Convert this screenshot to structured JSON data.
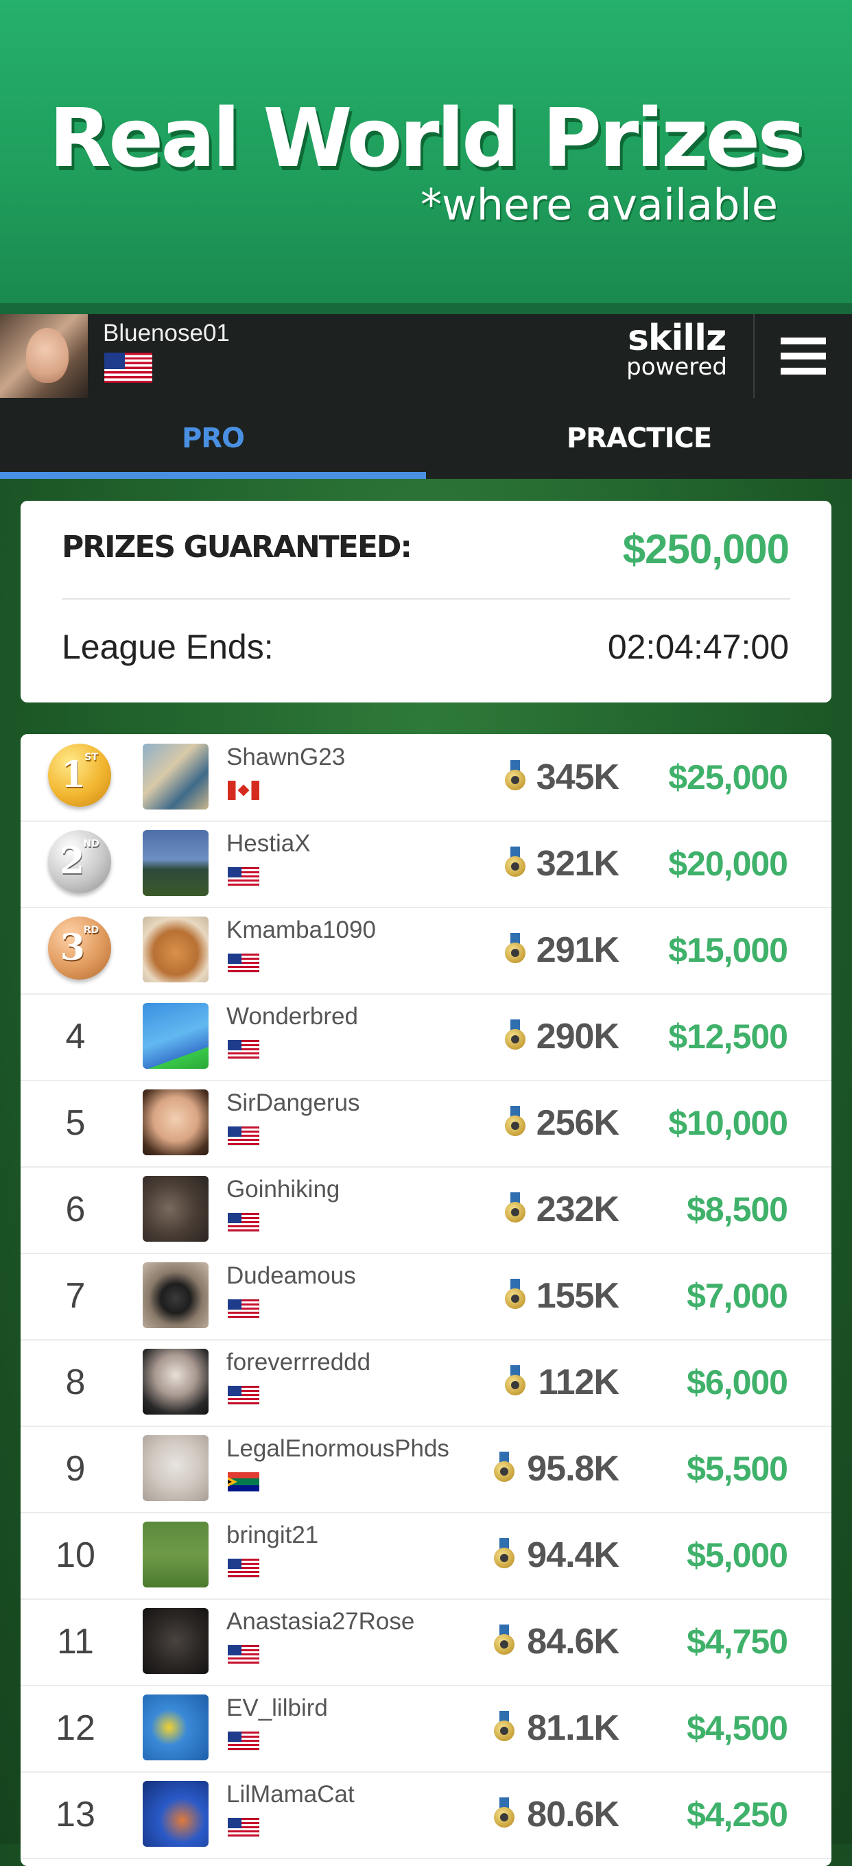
{
  "hero": {
    "title": "Real World Prizes",
    "subtitle": "*where available"
  },
  "header": {
    "username": "Bluenose01",
    "brand": "skillz",
    "brand_sub": "powered"
  },
  "tabs": [
    {
      "label": "PRO",
      "active": true
    },
    {
      "label": "PRACTICE",
      "active": false
    }
  ],
  "prizes": {
    "guaranteed_label": "PRIZES GUARANTEED:",
    "guaranteed_value": "$250,000",
    "league_label": "League Ends:",
    "league_value": "02:04:47:00"
  },
  "leaderboard": [
    {
      "rank": "1",
      "medal": "gold",
      "suffix": "ST",
      "name": "ShawnG23",
      "flag": "ca",
      "score": "345K",
      "prize": "$25,000"
    },
    {
      "rank": "2",
      "medal": "silver",
      "suffix": "ND",
      "name": "HestiaX",
      "flag": "us",
      "score": "321K",
      "prize": "$20,000"
    },
    {
      "rank": "3",
      "medal": "bronze",
      "suffix": "RD",
      "name": "Kmamba1090",
      "flag": "us",
      "score": "291K",
      "prize": "$15,000"
    },
    {
      "rank": "4",
      "name": "Wonderbred",
      "flag": "us",
      "score": "290K",
      "prize": "$12,500"
    },
    {
      "rank": "5",
      "name": "SirDangerus",
      "flag": "us",
      "score": "256K",
      "prize": "$10,000"
    },
    {
      "rank": "6",
      "name": "Goinhiking",
      "flag": "us",
      "score": "232K",
      "prize": "$8,500"
    },
    {
      "rank": "7",
      "name": "Dudeamous",
      "flag": "us",
      "score": "155K",
      "prize": "$7,000"
    },
    {
      "rank": "8",
      "name": "foreverrreddd",
      "flag": "us",
      "score": "112K",
      "prize": "$6,000"
    },
    {
      "rank": "9",
      "name": "LegalEnormousPhds",
      "flag": "za",
      "score": "95.8K",
      "prize": "$5,500"
    },
    {
      "rank": "10",
      "name": "bringit21",
      "flag": "us",
      "score": "94.4K",
      "prize": "$5,000"
    },
    {
      "rank": "11",
      "name": "Anastasia27Rose",
      "flag": "us",
      "score": "84.6K",
      "prize": "$4,750"
    },
    {
      "rank": "12",
      "name": "EV_lilbird",
      "flag": "us",
      "score": "81.1K",
      "prize": "$4,500"
    },
    {
      "rank": "13",
      "name": "LilMamaCat",
      "flag": "us",
      "score": "80.6K",
      "prize": "$4,250"
    }
  ]
}
